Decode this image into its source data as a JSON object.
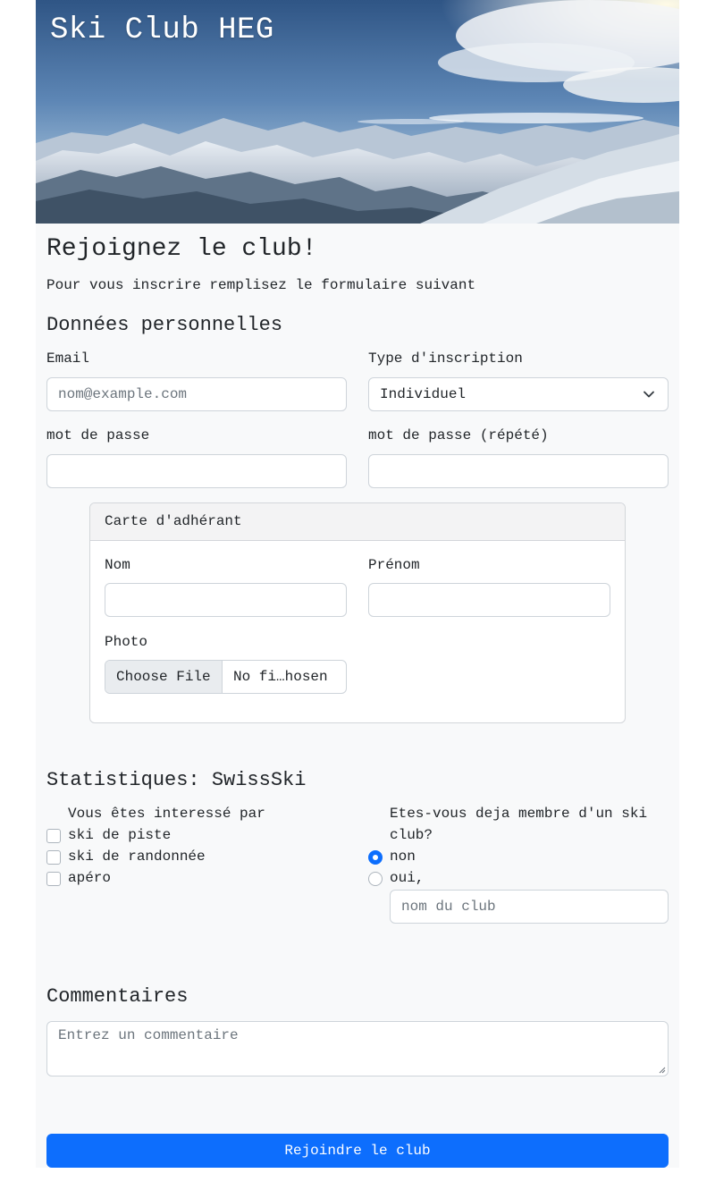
{
  "header": {
    "title": "Ski Club HEG"
  },
  "intro": {
    "heading": "Rejoignez le club!",
    "subtitle": "Pour vous inscrire remplisez le formulaire suivant"
  },
  "personal": {
    "heading": "Données personnelles",
    "email_label": "Email",
    "email_placeholder": "nom@example.com",
    "type_label": "Type d'inscription",
    "type_value": "Individuel",
    "password_label": "mot de passe",
    "password_repeat_label": "mot de passe (répété)"
  },
  "card": {
    "header": "Carte d'adhérant",
    "nom_label": "Nom",
    "prenom_label": "Prénom",
    "photo_label": "Photo",
    "file_button": "Choose File",
    "file_status": "No fi…hosen"
  },
  "stats": {
    "heading": "Statistiques: SwissSki",
    "interest_label": "Vous êtes interessé par",
    "interests": [
      "ski de piste",
      "ski de randonnée",
      "apéro"
    ],
    "member_question": "Etes-vous deja membre d'un ski club?",
    "member_question_line1": "Etes-vous deja membre d'un ski",
    "member_question_line2": "club?",
    "options": [
      "non",
      "oui,"
    ],
    "selected_option": "non",
    "club_placeholder": "nom du club"
  },
  "comments": {
    "heading": "Commentaires",
    "placeholder": "Entrez un commentaire"
  },
  "submit": {
    "label": "Rejoindre le club"
  },
  "colors": {
    "primary": "#0d6efd",
    "page_bg": "#f8f9fa",
    "border": "#ced4da"
  }
}
